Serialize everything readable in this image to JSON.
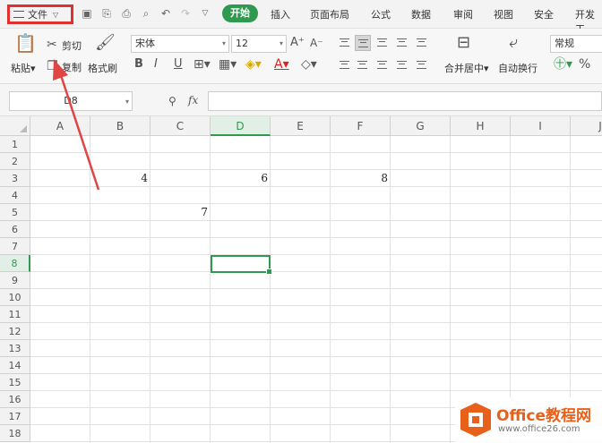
{
  "menu": {
    "file_label": "文件",
    "tabs": [
      "插入",
      "页面布局",
      "公式",
      "数据",
      "审阅",
      "视图",
      "安全",
      "开发工"
    ],
    "active_tab": "开始"
  },
  "ribbon": {
    "paste_label": "粘贴",
    "cut_label": "剪切",
    "copy_label": "复制",
    "format_painter_label": "格式刷",
    "font_name": "宋体",
    "font_size": "12",
    "merge_label": "合并居中",
    "wrap_label": "自动换行",
    "number_format": "常规"
  },
  "formula_bar": {
    "name_box": "D8",
    "fx_label": "fx",
    "formula": ""
  },
  "sheet": {
    "columns": [
      "A",
      "B",
      "C",
      "D",
      "E",
      "F",
      "G",
      "H",
      "I",
      "J"
    ],
    "rows": [
      "1",
      "2",
      "3",
      "4",
      "5",
      "6",
      "7",
      "8",
      "9",
      "10",
      "11",
      "12",
      "13",
      "14",
      "15",
      "16",
      "17",
      "18"
    ],
    "active_column": "D",
    "active_row": "8",
    "cells": [
      {
        "ref": "B3",
        "value": "4"
      },
      {
        "ref": "D3",
        "value": "6"
      },
      {
        "ref": "F3",
        "value": "8"
      },
      {
        "ref": "C5",
        "value": "7"
      }
    ]
  },
  "watermark": {
    "title": "Office教程网",
    "url": "www.office26.com"
  },
  "colors": {
    "accent_green": "#2f9a4f",
    "highlight_red": "#e03030",
    "watermark_orange": "#e8611a"
  }
}
